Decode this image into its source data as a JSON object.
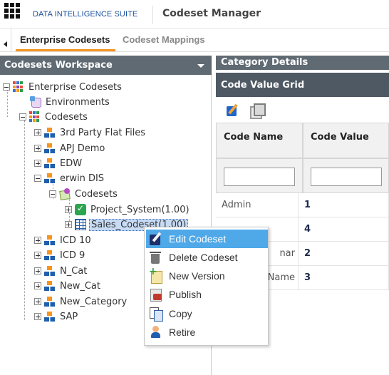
{
  "header": {
    "brand": "DATA INTELLIGENCE SUITE",
    "module_title": "Codeset Manager"
  },
  "tabs": [
    {
      "label": "Enterprise Codesets",
      "active": true
    },
    {
      "label": "Codeset Mappings",
      "active": false
    }
  ],
  "workspace": {
    "title": "Codesets Workspace",
    "tree": [
      {
        "label": "Enterprise Codesets",
        "icon": "enterprise-grid-icon",
        "expanded": true
      },
      {
        "label": "Environments",
        "icon": "environment-db-icon"
      },
      {
        "label": "Codesets",
        "icon": "enterprise-grid-icon",
        "expanded": true
      },
      {
        "label": "3rd Party Flat Files",
        "icon": "network-node-icon"
      },
      {
        "label": "APJ Demo",
        "icon": "network-node-icon"
      },
      {
        "label": "EDW",
        "icon": "network-node-icon"
      },
      {
        "label": "erwin DIS",
        "icon": "network-node-icon",
        "expanded": true
      },
      {
        "label": "Codesets",
        "icon": "codeset-folder-icon",
        "expanded": true
      },
      {
        "label": "Project_System(1.00)",
        "icon": "published-check-icon"
      },
      {
        "label": "Sales_Codeset(1.00)",
        "icon": "table-icon",
        "selected": true
      },
      {
        "label": "ICD 10",
        "icon": "network-node-icon"
      },
      {
        "label": "ICD 9",
        "icon": "network-node-icon"
      },
      {
        "label": "N_Cat",
        "icon": "network-node-icon"
      },
      {
        "label": "New_Cat",
        "icon": "network-node-icon"
      },
      {
        "label": "New_Category",
        "icon": "network-node-icon"
      },
      {
        "label": "SAP",
        "icon": "network-node-icon"
      }
    ]
  },
  "category_details": {
    "title": "Category Details"
  },
  "grid": {
    "title": "Code Value Grid",
    "toolbar": [
      "edit-icon",
      "copy-icon"
    ],
    "columns": [
      "Code Name",
      "Code Value"
    ],
    "filters": [
      "",
      ""
    ],
    "rows": [
      {
        "name": "Admin",
        "value": "1"
      },
      {
        "name": "",
        "value": "4"
      },
      {
        "name": "nar",
        "value": "2"
      },
      {
        "name": "Name",
        "value": "3"
      }
    ]
  },
  "context_menu": {
    "items": [
      {
        "label": "Edit Codeset",
        "icon": "edit-codeset-icon",
        "highlighted": true
      },
      {
        "label": "Delete Codeset",
        "icon": "trash-icon"
      },
      {
        "label": "New Version",
        "icon": "new-version-icon"
      },
      {
        "label": "Publish",
        "icon": "publish-icon"
      },
      {
        "label": "Copy",
        "icon": "copy-icon"
      },
      {
        "label": "Retire",
        "icon": "retire-icon"
      }
    ]
  },
  "colors": {
    "panel_header": "#606a73",
    "grid_header": "#4e5963",
    "tab_accent": "#f7941d",
    "menu_highlight": "#4fa8e8",
    "brand": "#1a4f9c"
  }
}
